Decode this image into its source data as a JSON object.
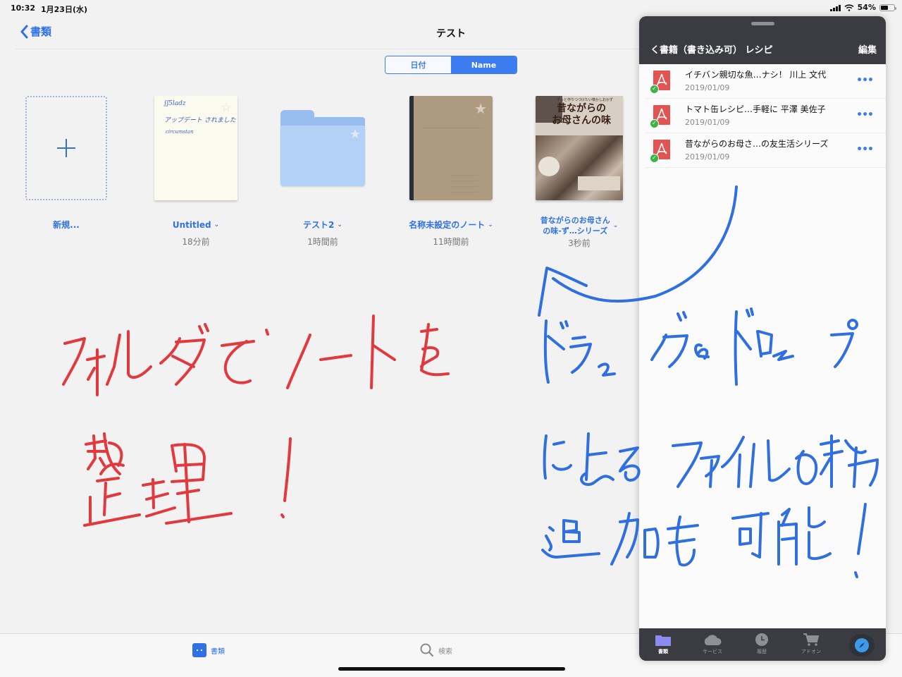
{
  "status_bar": {
    "time": "10:32",
    "date": "1月23日(水)",
    "battery": "54%",
    "battery_level": 0.54
  },
  "nav": {
    "back_label": "書類",
    "title": "テスト"
  },
  "sort": {
    "options": [
      "日付",
      "Name"
    ],
    "selected": "Name"
  },
  "items": [
    {
      "type": "new",
      "name": "新規...",
      "time": ""
    },
    {
      "type": "note",
      "name": "Untitled",
      "time": "18分前",
      "preview_lines": [
        "∫ʃ5ladz",
        "アップデート されました",
        "circumstan"
      ]
    },
    {
      "type": "folder",
      "name": "テスト2",
      "time": "1時間前"
    },
    {
      "type": "notebook",
      "name": "名称未設定のノート",
      "time": "11時間前"
    },
    {
      "type": "book",
      "name_line1": "昔ながらのお母さん",
      "name_line2": "の味-ず…シリーズ",
      "time": "3秒前",
      "cover_subtitle": "ずっと作りつづけたい懐かしおかず",
      "cover_title_line1": "昔ながらの",
      "cover_title_line2": "お母さんの味"
    }
  ],
  "annotations": {
    "red_text": "フォルダでノートを整理!",
    "blue_text": "ドラッグ&ドロップによるファイルの移動追加も可能!",
    "red_color": "#e2393f",
    "blue_color": "#2f6fe0"
  },
  "bottom_tabs": [
    {
      "label": "書類",
      "icon": "documents-grid-icon",
      "active": true
    },
    {
      "label": "検索",
      "icon": "search-icon",
      "active": false
    }
  ],
  "panel": {
    "back_label": "く書籍（書き込み可） レシピ",
    "edit_label": "編集",
    "files": [
      {
        "name": "イチバン親切な魚…ナシ！ 川上 文代",
        "date": "2019/01/09",
        "synced": true
      },
      {
        "name": "トマト缶レシピ…手軽に 平澤 美佐子",
        "date": "2019/01/09",
        "synced": true
      },
      {
        "name": "昔ながらのお母さ…の友生活シリーズ",
        "date": "2019/01/09",
        "synced": true
      }
    ],
    "more_label": "•••",
    "tabs": [
      {
        "label": "書類",
        "icon": "folder-icon",
        "active": true
      },
      {
        "label": "サービス",
        "icon": "cloud-icon",
        "active": false
      },
      {
        "label": "履歴",
        "icon": "clock-icon",
        "active": false
      },
      {
        "label": "アドオン",
        "icon": "cart-icon",
        "active": false
      }
    ]
  },
  "colors": {
    "accent": "#2f72e8",
    "panel_header": "#3a3c42",
    "pdf_red": "#e3534f",
    "sync_green": "#3cb34a"
  }
}
